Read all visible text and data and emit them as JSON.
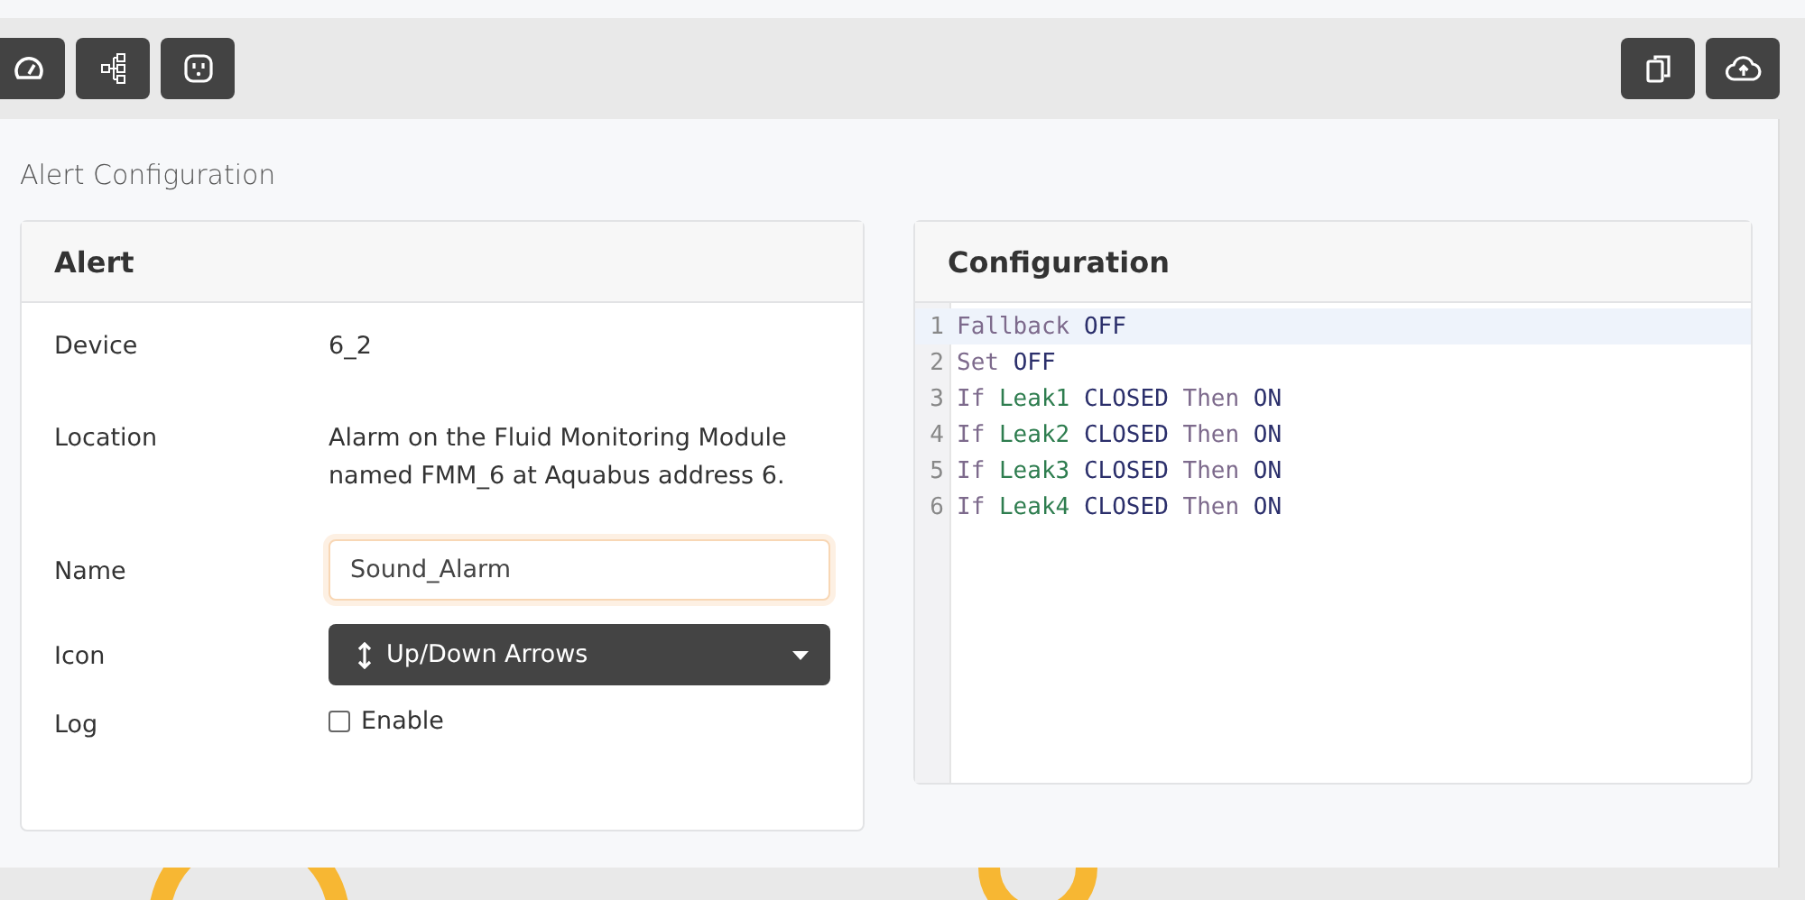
{
  "page_title": "Alert Configuration",
  "alert_card": {
    "title": "Alert",
    "fields": [
      {
        "kind": "text",
        "label": "Device",
        "value": "6_2"
      },
      {
        "kind": "text",
        "label": "Location",
        "value": "Alarm on the Fluid Monitoring Module named FMM_6 at Aquabus address 6."
      },
      {
        "kind": "input",
        "label": "Name",
        "value": "Sound_Alarm",
        "focused": true
      },
      {
        "kind": "select",
        "label": "Icon",
        "value": "Up/Down Arrows"
      },
      {
        "kind": "checkbox",
        "label": "Log",
        "value": "Enable",
        "checked": false
      }
    ]
  },
  "config_card": {
    "title": "Configuration",
    "lines": [
      {
        "number": "1",
        "selected": true,
        "tokens": [
          {
            "text": "Fallback",
            "kind": "keyword"
          },
          {
            "text": "OFF",
            "kind": "value"
          }
        ]
      },
      {
        "number": "2",
        "selected": false,
        "tokens": [
          {
            "text": "Set",
            "kind": "keyword"
          },
          {
            "text": "OFF",
            "kind": "value"
          }
        ]
      },
      {
        "number": "3",
        "selected": false,
        "tokens": [
          {
            "text": "If",
            "kind": "keyword"
          },
          {
            "text": "Leak1",
            "kind": "name"
          },
          {
            "text": "CLOSED",
            "kind": "value"
          },
          {
            "text": "Then",
            "kind": "keyword"
          },
          {
            "text": "ON",
            "kind": "value"
          }
        ]
      },
      {
        "number": "4",
        "selected": false,
        "tokens": [
          {
            "text": "If",
            "kind": "keyword"
          },
          {
            "text": "Leak2",
            "kind": "name"
          },
          {
            "text": "CLOSED",
            "kind": "value"
          },
          {
            "text": "Then",
            "kind": "keyword"
          },
          {
            "text": "ON",
            "kind": "value"
          }
        ]
      },
      {
        "number": "5",
        "selected": false,
        "tokens": [
          {
            "text": "If",
            "kind": "keyword"
          },
          {
            "text": "Leak3",
            "kind": "name"
          },
          {
            "text": "CLOSED",
            "kind": "value"
          },
          {
            "text": "Then",
            "kind": "keyword"
          },
          {
            "text": "ON",
            "kind": "value"
          }
        ]
      },
      {
        "number": "6",
        "selected": false,
        "tokens": [
          {
            "text": "If",
            "kind": "keyword"
          },
          {
            "text": "Leak4",
            "kind": "name"
          },
          {
            "text": "CLOSED",
            "kind": "value"
          },
          {
            "text": "Then",
            "kind": "keyword"
          },
          {
            "text": "ON",
            "kind": "value"
          }
        ]
      }
    ]
  }
}
